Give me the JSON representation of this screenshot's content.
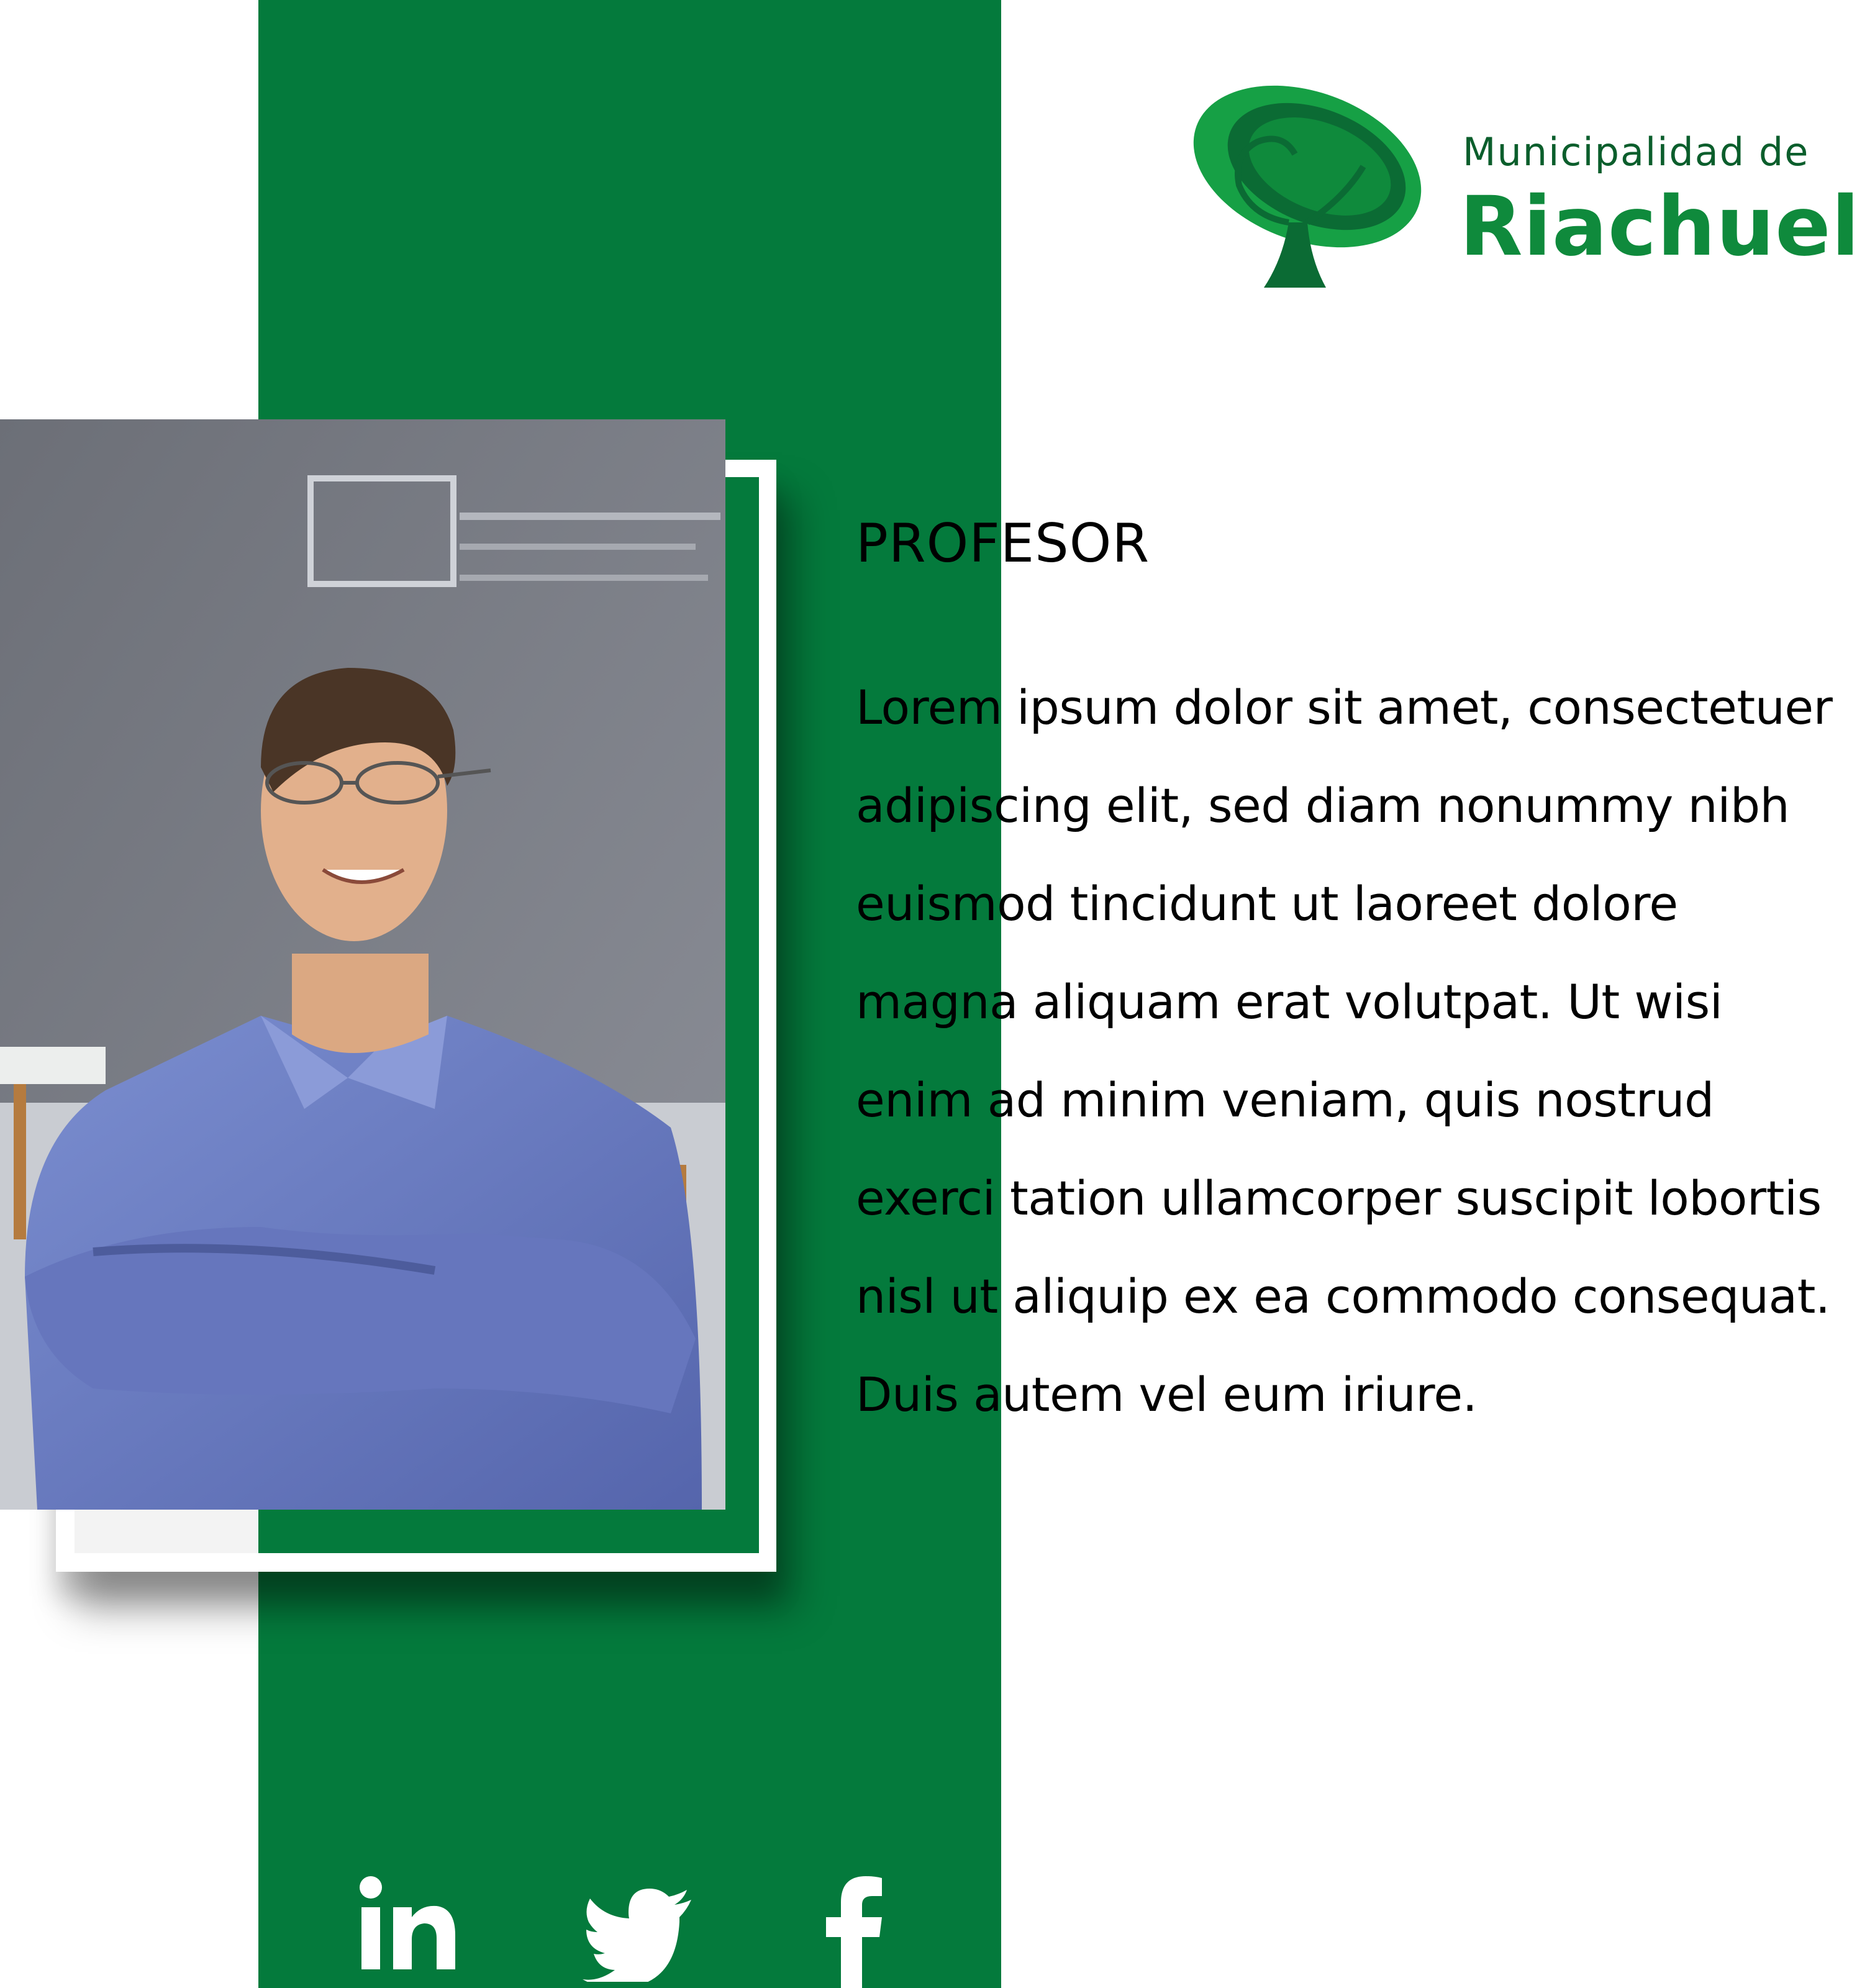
{
  "logo": {
    "line1": "Municipalidad de",
    "line2": "Riachuelo",
    "icon": "tree-logo-icon"
  },
  "profile": {
    "role": "PROFESOR",
    "description": "Lorem ipsum dolor sit amet, consectetuer adipiscing elit, sed diam nonummy nibh euismod tincidunt ut laoreet dolore magna aliquam erat volutpat. Ut wisi enim ad minim veniam, quis nostrud exerci tation ullamcorper suscipit lobortis nisl ut aliquip ex ea commodo consequat. Duis autem vel eum iriure.",
    "photo": "profile-photo"
  },
  "social": {
    "linkedin_icon": "linkedin-icon",
    "twitter_icon": "twitter-icon",
    "facebook_icon": "facebook-icon"
  },
  "colors": {
    "brand_green": "#047a3c",
    "logo_green": "#0f8a3c",
    "background": "#ffffff"
  }
}
